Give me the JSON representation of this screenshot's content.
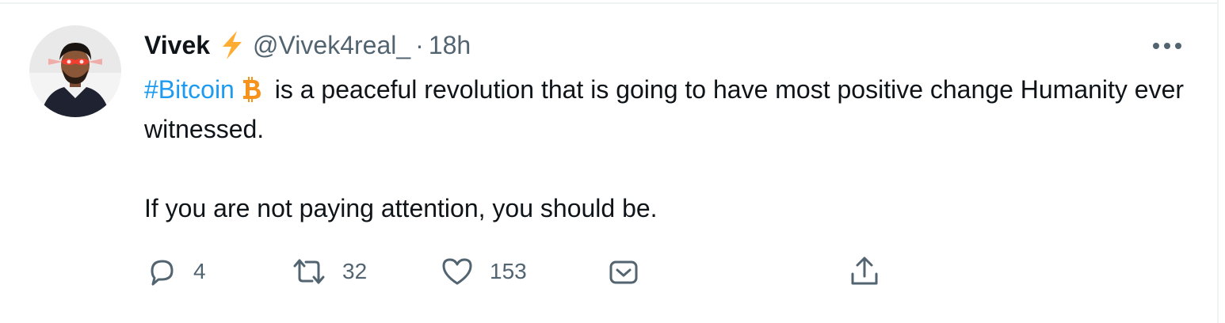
{
  "tweet": {
    "author": {
      "display_name": "Vivek",
      "name_emoji_icon": "lightning-bolt-icon",
      "handle": "@Vivek4real_",
      "separator": "·",
      "time": "18h"
    },
    "text": {
      "hashtag": "#Bitcoin",
      "hashtag_emoji_icon": "bitcoin-icon",
      "line1_rest": " is a peaceful revolution that is going to have most positive change Humanity ever witnessed.",
      "line2": "If you are not paying attention, you should be."
    },
    "actions": {
      "reply_count": "4",
      "retweet_count": "32",
      "like_count": "153"
    }
  },
  "colors": {
    "text": "#0f1419",
    "secondary": "#536471",
    "link": "#1d9bf0",
    "bolt": "#ffac33",
    "bitcoin": "#f7931a",
    "divider": "#eff3f4"
  }
}
